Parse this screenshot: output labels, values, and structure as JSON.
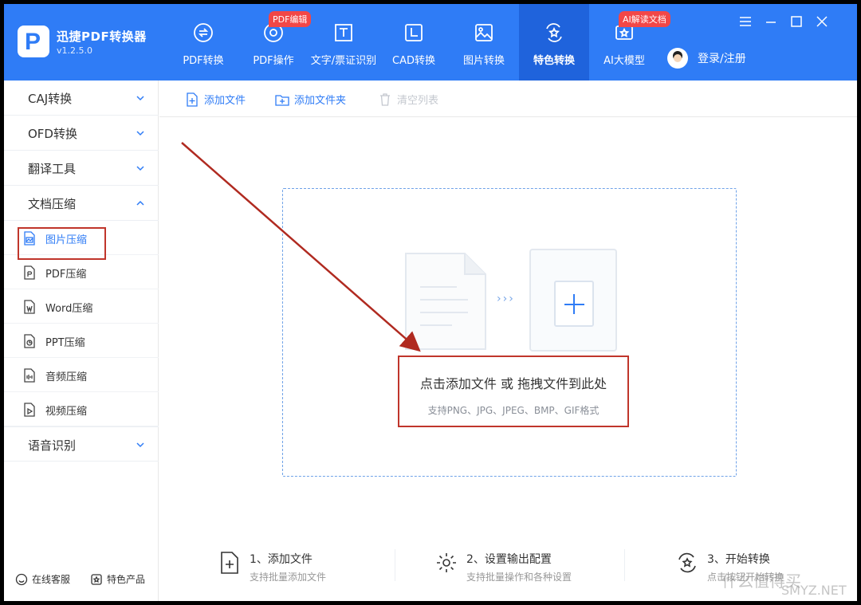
{
  "app": {
    "name": "迅捷PDF转换器",
    "version": "v1.2.5.0"
  },
  "nav": [
    {
      "label": "PDF转换",
      "icon": "pdf-convert-icon"
    },
    {
      "label": "PDF操作",
      "icon": "pdf-operate-icon",
      "badge": "PDF编辑"
    },
    {
      "label": "文字/票证识别",
      "icon": "text-ocr-icon"
    },
    {
      "label": "CAD转换",
      "icon": "cad-icon"
    },
    {
      "label": "图片转换",
      "icon": "image-icon"
    },
    {
      "label": "特色转换",
      "icon": "feature-icon",
      "active": true
    },
    {
      "label": "AI大模型",
      "icon": "ai-icon",
      "badge": "AI解读文档"
    }
  ],
  "login": {
    "label": "登录/注册"
  },
  "sidebar": {
    "categories": [
      {
        "label": "CAJ转换",
        "expanded": false
      },
      {
        "label": "OFD转换",
        "expanded": false
      },
      {
        "label": "翻译工具",
        "expanded": false
      },
      {
        "label": "文档压缩",
        "expanded": true
      },
      {
        "label": "语音识别",
        "expanded": false
      }
    ],
    "items": [
      {
        "label": "图片压缩",
        "active": true
      },
      {
        "label": "PDF压缩"
      },
      {
        "label": "Word压缩"
      },
      {
        "label": "PPT压缩"
      },
      {
        "label": "音频压缩"
      },
      {
        "label": "视频压缩"
      }
    ],
    "footer": {
      "service": "在线客服",
      "products": "特色产品"
    }
  },
  "toolbar": {
    "add_file": "添加文件",
    "add_folder": "添加文件夹",
    "clear_list": "清空列表"
  },
  "dropzone": {
    "main": "点击添加文件 或 拖拽文件到此处",
    "sub": "支持PNG、JPG、JPEG、BMP、GIF格式",
    "arrows": "›››"
  },
  "steps": [
    {
      "title": "1、添加文件",
      "desc": "支持批量添加文件"
    },
    {
      "title": "2、设置输出配置",
      "desc": "支持批量操作和各种设置"
    },
    {
      "title": "3、开始转换",
      "desc": "点击按钮开始转换"
    }
  ],
  "watermark": {
    "top": "什么值得买",
    "bottom": "SMYZ.NET"
  },
  "colors": {
    "primary": "#2f7cf6",
    "active_nav": "#1f63dc",
    "annotation": "#c0352b",
    "badge": "#f24747"
  }
}
